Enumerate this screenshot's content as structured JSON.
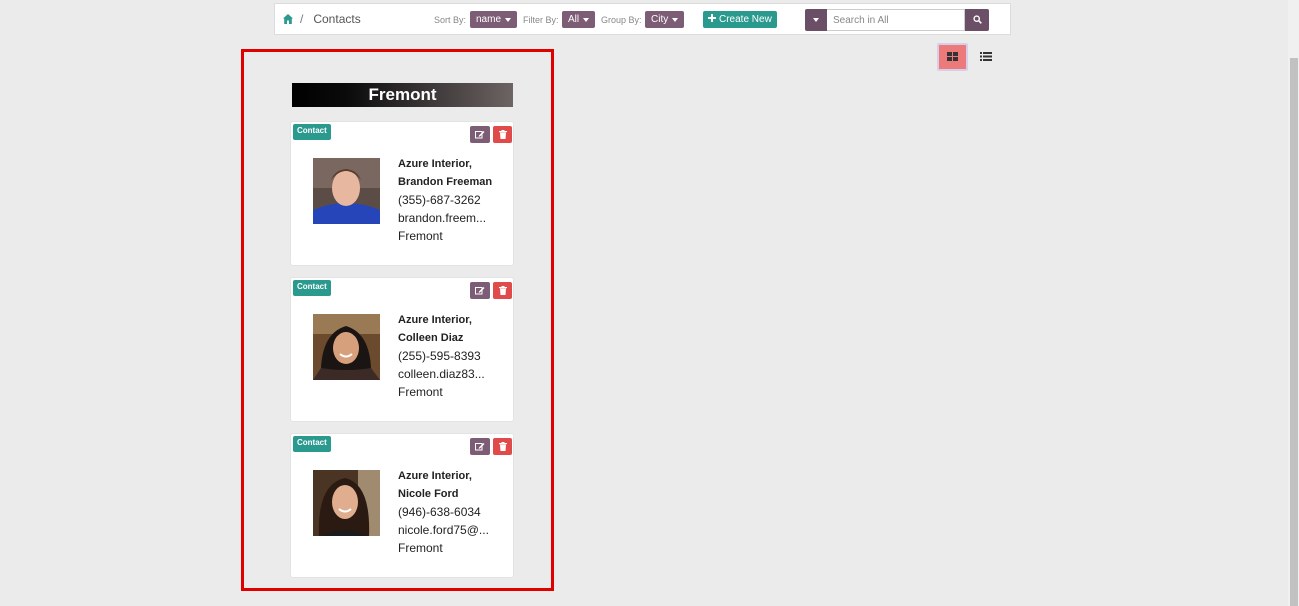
{
  "breadcrumb": {
    "current": "Contacts",
    "separator": "/"
  },
  "controls": {
    "sort_label": "Sort By:",
    "sort_value": "name",
    "filter_label": "Filter By:",
    "filter_value": "All",
    "group_label": "Group By:",
    "group_value": "City",
    "create_label": "Create New",
    "search_placeholder": "Search in All"
  },
  "group": {
    "title": "Fremont"
  },
  "contacts": [
    {
      "badge": "Contact",
      "name": "Azure Interior, Brandon Freeman",
      "phone": "(355)-687-3262",
      "email": "brandon.freem...",
      "city": "Fremont"
    },
    {
      "badge": "Contact",
      "name": "Azure Interior, Colleen Diaz",
      "phone": "(255)-595-8393",
      "email": "colleen.diaz83...",
      "city": "Fremont"
    },
    {
      "badge": "Contact",
      "name": "Azure Interior, Nicole Ford",
      "phone": "(946)-638-6034",
      "email": "nicole.ford75@...",
      "city": "Fremont"
    }
  ],
  "colors": {
    "accent_teal": "#2b9a8e",
    "accent_purple": "#7c5d75",
    "danger_red": "#e14a4a",
    "highlight_red": "#e00000",
    "active_view": "#ed7a7a"
  },
  "icons": [
    "home-icon",
    "caret-down-icon",
    "plus-icon",
    "search-icon",
    "grid-icon",
    "list-icon",
    "edit-icon",
    "trash-icon"
  ]
}
